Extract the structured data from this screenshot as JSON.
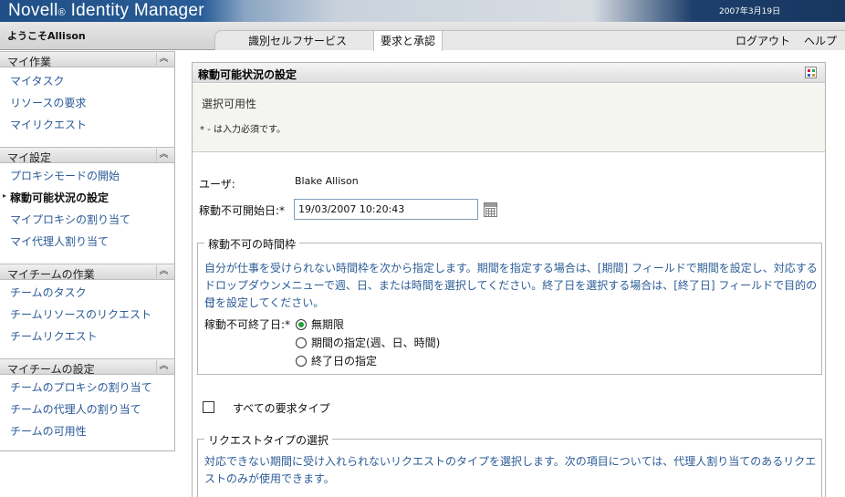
{
  "app": {
    "brand": "Novell",
    "brand_reg": "®",
    "product": " Identity Manager",
    "date": "2007年3月19日"
  },
  "header": {
    "welcome": "ようこそAllison",
    "tabs": [
      {
        "label": "識別セルフサービス"
      },
      {
        "label": "要求と承認"
      }
    ],
    "logout": "ログアウト",
    "help": "ヘルプ"
  },
  "sidebar": {
    "sections": [
      {
        "title": "マイ作業",
        "items": [
          "マイタスク",
          "リソースの要求",
          "マイリクエスト"
        ]
      },
      {
        "title": "マイ設定",
        "items": [
          "プロキシモードの開始",
          "稼動可能状況の設定",
          "マイプロキシの割り当て",
          "マイ代理人割り当て"
        ]
      },
      {
        "title": "マイチームの作業",
        "items": [
          "チームのタスク",
          "チームリソースのリクエスト",
          "チームリクエスト"
        ]
      },
      {
        "title": "マイチームの設定",
        "items": [
          "チームのプロキシの割り当て",
          "チームの代理人の割り当て",
          "チームの可用性"
        ]
      }
    ]
  },
  "panel": {
    "title": "稼動可能状況の設定",
    "subtitle": "選択可用性",
    "required_note": "* - は入力必須です。",
    "user_label": "ユーザ:",
    "user_value": "Blake Allison",
    "start_label": "稼動不可開始日:*",
    "start_value": "19/03/2007 10:20:43",
    "timeframe": {
      "legend": "稼動不可の時間枠",
      "desc_1": "自分が仕事を受けられない時間枠を次から指定します。期間を指定する場合は、[期間] フィールドで期間を設定し、対応する",
      "desc_2": "ドロップダウンメニューで週、日、または時間を選択してください。終了日を選択する場合は、[終了日] フィールドで目的の日",
      "desc_3": "付を設定してください。",
      "end_label": "稼動不可終了日:*",
      "options": [
        "無期限",
        "期間の指定(週、日、時間)",
        "終了日の指定"
      ],
      "selected": "無期限"
    },
    "all_types_label": "すべての要求タイプ",
    "request_types": {
      "legend": "リクエストタイプの選択",
      "desc_1": "対応できない期間に受け入れられないリクエストのタイプを選択します。次の項目については、代理人割り当てのあるリクエ",
      "desc_2": "ストのみが使用できます。"
    }
  }
}
